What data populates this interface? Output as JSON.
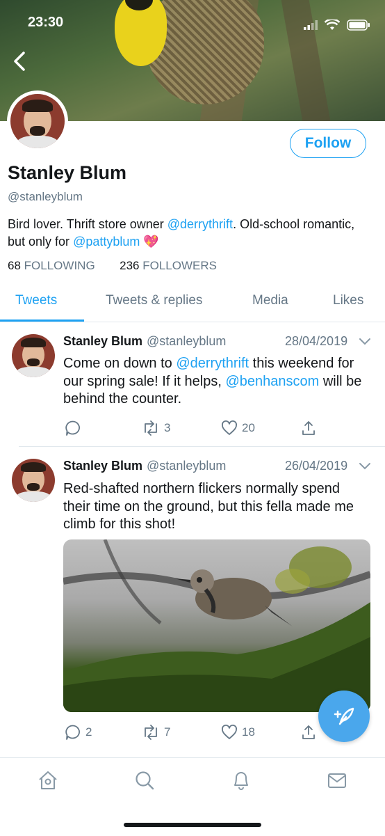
{
  "status_bar": {
    "time": "23:30"
  },
  "profile": {
    "name": "Stanley Blum",
    "handle": "@stanleyblum",
    "follow_label": "Follow",
    "bio": {
      "part1": "Bird lover. Thrift store owner ",
      "mention1": "@derrythrift",
      "part2": ". Old-school romantic, but only for ",
      "mention2": "@pattyblum",
      "emoji": "💖"
    },
    "following_count": "68",
    "following_label": "FOLLOWING",
    "followers_count": "236",
    "followers_label": "FOLLOWERS"
  },
  "tabs": [
    {
      "label": "Tweets",
      "active": true
    },
    {
      "label": "Tweets & replies"
    },
    {
      "label": "Media"
    },
    {
      "label": "Likes"
    }
  ],
  "tweets": [
    {
      "name": "Stanley Blum",
      "handle": "@stanleyblum",
      "date": "28/04/2019",
      "text": {
        "part1": "Come on down to ",
        "mention1": "@derrythrift",
        "part2": " this weekend for our spring sale! If it helps, ",
        "mention2": "@benhanscom",
        "part3": " will be behind the counter."
      },
      "replies": "",
      "retweets": "3",
      "likes": "20"
    },
    {
      "name": "Stanley Blum",
      "handle": "@stanleyblum",
      "date": "26/04/2019",
      "text": "Red-shafted northern flickers normally spend their time on the ground, but this fella made me climb for this shot!",
      "replies": "2",
      "retweets": "7",
      "likes": "18"
    }
  ],
  "colors": {
    "accent": "#1da1f2",
    "secondary_text": "#657786",
    "divider": "#e1e8ed"
  },
  "nav": [
    "home-icon",
    "search-icon",
    "notifications-icon",
    "messages-icon"
  ]
}
